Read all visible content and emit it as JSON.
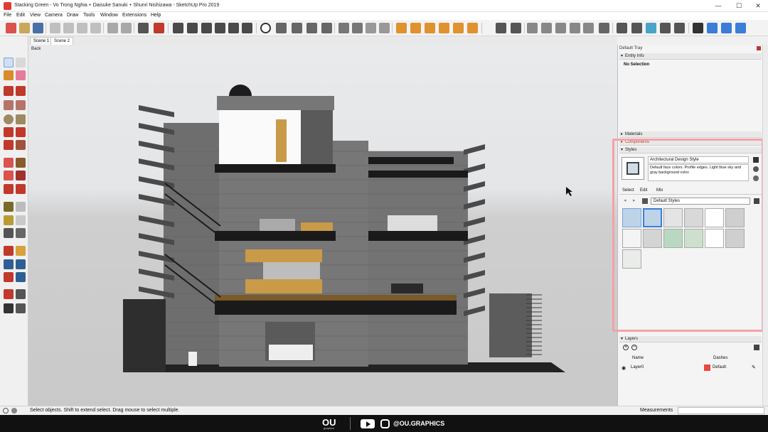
{
  "window": {
    "title": "Stacking Green - Vo Trong Nghia + Daisuke Sanuki + Shunri Nishizawa - SketchUp Pro 2019",
    "minimize": "—",
    "maximize": "☐",
    "close": "✕"
  },
  "menu": [
    "File",
    "Edit",
    "View",
    "Camera",
    "Draw",
    "Tools",
    "Window",
    "Extensions",
    "Help"
  ],
  "scenes": {
    "tabs": [
      "Scene 1",
      "Scene 2"
    ],
    "active": "Scene 2"
  },
  "viewport": {
    "back_label": "Back"
  },
  "tray": {
    "title": "Default Tray",
    "entity_info": {
      "header": "Entity Info",
      "value": "No Selection"
    },
    "materials": "Materials",
    "components": "Components",
    "styles": {
      "header": "Styles",
      "style_name": "Architectural Design Style",
      "style_desc": "Default face colors. Profile edges. Light blue sky and gray background color.",
      "tabs": [
        "Select",
        "Edit",
        "Mix"
      ],
      "collection": "Default Styles"
    },
    "layers": {
      "header": "Layers",
      "col_name": "Name",
      "col_dashes": "Dashes",
      "row_name": "Layer0",
      "row_dashes": "Default",
      "swatch_color": "#e8483d"
    }
  },
  "status": {
    "hint": "Select objects. Shift to extend select. Drag mouse to select multiple.",
    "measurements": "Measurements"
  },
  "overlay": {
    "brand": "OU",
    "brand_sub": "graphics",
    "handle": "@OU.GRAPHICS"
  },
  "colors": {
    "accent_red": "#e03c31",
    "highlight_box": "#f2a3a8",
    "wood": "#c99a48"
  }
}
